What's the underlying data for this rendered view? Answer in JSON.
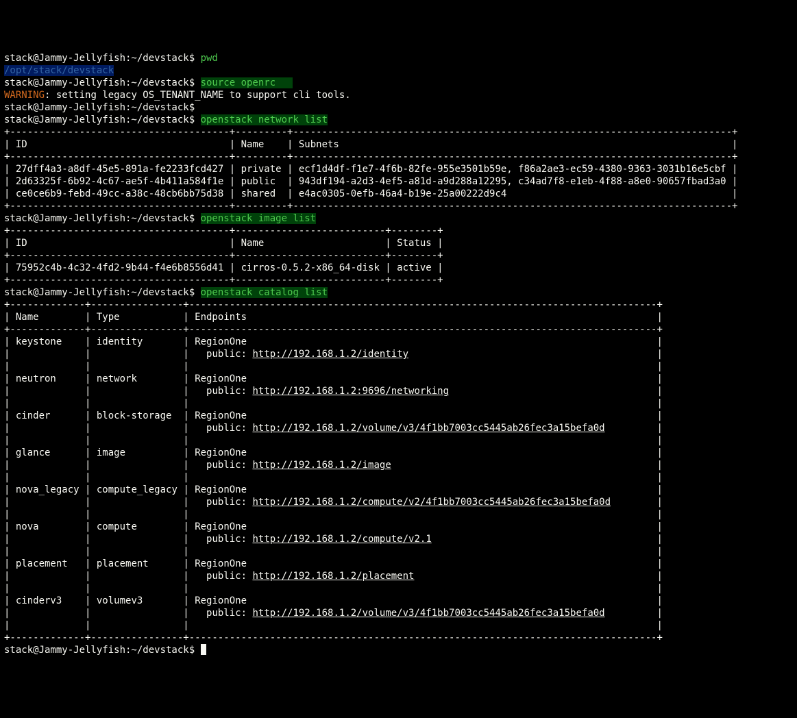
{
  "prompt": "stack@Jammy-Jellyfish:~/devstack$ ",
  "cmd_pwd": "pwd",
  "pwd_out": "/opt/stack/devstack",
  "cmd_source": "source openrc   ",
  "warning_label": "WARNING",
  "warning_msg": ": setting legacy OS_TENANT_NAME to support cli tools.",
  "cmd_netlist": "openstack network list",
  "net_border": "+--------------------------------------+---------+----------------------------------------------------------------------------+",
  "net_header": "| ID                                   | Name    | Subnets                                                                    |",
  "net_rows": [
    "| 27dff4a3-a8df-45e5-891a-fe2233fcd427 | private | ecf1d4df-f1e7-4f6b-82fe-955e3501b59e, f86a2ae3-ec59-4380-9363-3031b16e5cbf |",
    "| 2d63325f-6b92-4c67-ae5f-4b411a584f1e | public  | 943df194-a2d3-4ef5-a81d-a9d288a12295, c34ad7f8-e1eb-4f88-a8e0-90657fbad3a0 |",
    "| ce0ce6b9-febd-49cc-a38c-48cb6bb75d38 | shared  | e4ac0305-0efb-46a4-b19e-25a00222d9c4                                       |"
  ],
  "cmd_imglist": "openstack image list",
  "img_border": "+--------------------------------------+--------------------------+--------+",
  "img_header": "| ID                                   | Name                     | Status |",
  "img_rows": [
    "| 75952c4b-4c32-4fd2-9b44-f4e6b8556d41 | cirros-0.5.2-x86_64-disk | active |"
  ],
  "cmd_catlist": "openstack catalog list",
  "cat_border": "+-------------+----------------+---------------------------------------------------------------------------------+",
  "cat_header": "| Name        | Type           | Endpoints                                                                       |",
  "cat_empty": "|             |                |                                                                                 |",
  "catalog": [
    {
      "name": "keystone",
      "type": "identity",
      "region": "RegionOne",
      "label": "public: ",
      "url": "http://192.168.1.2/identity"
    },
    {
      "name": "neutron",
      "type": "network",
      "region": "RegionOne",
      "label": "public: ",
      "url": "http://192.168.1.2:9696/networking"
    },
    {
      "name": "cinder",
      "type": "block-storage",
      "region": "RegionOne",
      "label": "public: ",
      "url": "http://192.168.1.2/volume/v3/4f1bb7003cc5445ab26fec3a15befa0d"
    },
    {
      "name": "glance",
      "type": "image",
      "region": "RegionOne",
      "label": "public: ",
      "url": "http://192.168.1.2/image"
    },
    {
      "name": "nova_legacy",
      "type": "compute_legacy",
      "region": "RegionOne",
      "label": "public: ",
      "url": "http://192.168.1.2/compute/v2/4f1bb7003cc5445ab26fec3a15befa0d"
    },
    {
      "name": "nova",
      "type": "compute",
      "region": "RegionOne",
      "label": "public: ",
      "url": "http://192.168.1.2/compute/v2.1"
    },
    {
      "name": "placement",
      "type": "placement",
      "region": "RegionOne",
      "label": "public: ",
      "url": "http://192.168.1.2/placement"
    },
    {
      "name": "cinderv3",
      "type": "volumev3",
      "region": "RegionOne",
      "label": "public: ",
      "url": "http://192.168.1.2/volume/v3/4f1bb7003cc5445ab26fec3a15befa0d"
    }
  ],
  "cat_col_widths": {
    "name": 11,
    "type": 14,
    "endpoints": 79
  }
}
